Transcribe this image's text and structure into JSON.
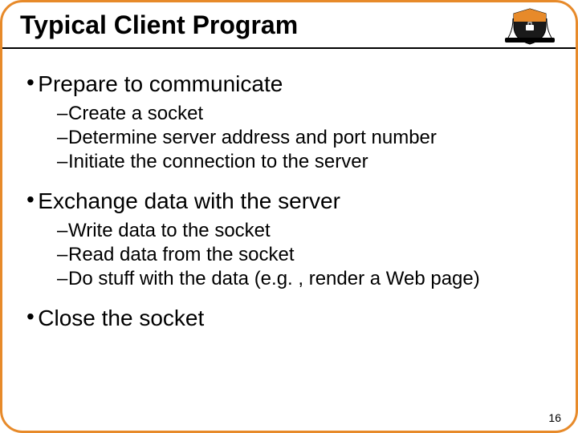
{
  "title": "Typical Client Program",
  "bullets": [
    {
      "text": "Prepare to communicate",
      "sub": [
        "Create a socket",
        "Determine server address and port number",
        "Initiate the connection to the server"
      ]
    },
    {
      "text": "Exchange data with the server",
      "sub": [
        "Write data to the socket",
        "Read data from the socket",
        "Do stuff with the data (e.g. , render a Web page)"
      ]
    },
    {
      "text": "Close the socket",
      "sub": []
    }
  ],
  "page_number": "16",
  "markers": {
    "top": "•",
    "sub": "–"
  }
}
